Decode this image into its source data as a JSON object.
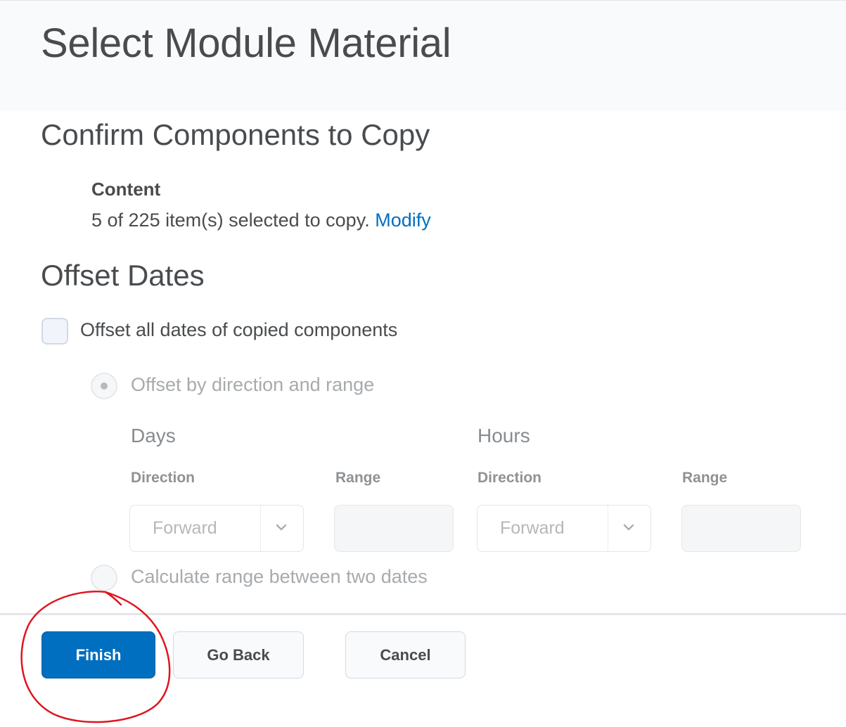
{
  "page": {
    "title": "Select Module Material"
  },
  "confirm": {
    "heading": "Confirm Components to Copy",
    "content_label": "Content",
    "summary": "5 of 225 item(s) selected to copy.",
    "modify_link": "Modify"
  },
  "offset": {
    "heading": "Offset Dates",
    "checkbox_label": "Offset all dates of copied components",
    "checkbox_checked": false,
    "option_direction_range": "Offset by direction and range",
    "option_calculate": "Calculate range between two dates",
    "days": {
      "title": "Days",
      "direction_label": "Direction",
      "direction_value": "Forward",
      "range_label": "Range",
      "range_value": ""
    },
    "hours": {
      "title": "Hours",
      "direction_label": "Direction",
      "direction_value": "Forward",
      "range_label": "Range",
      "range_value": ""
    }
  },
  "footer": {
    "finish_label": "Finish",
    "back_label": "Go Back",
    "cancel_label": "Cancel"
  },
  "colors": {
    "primary": "#006fbf",
    "text": "#494c4e",
    "link": "#006fbf",
    "annotation": "#e0141e"
  }
}
